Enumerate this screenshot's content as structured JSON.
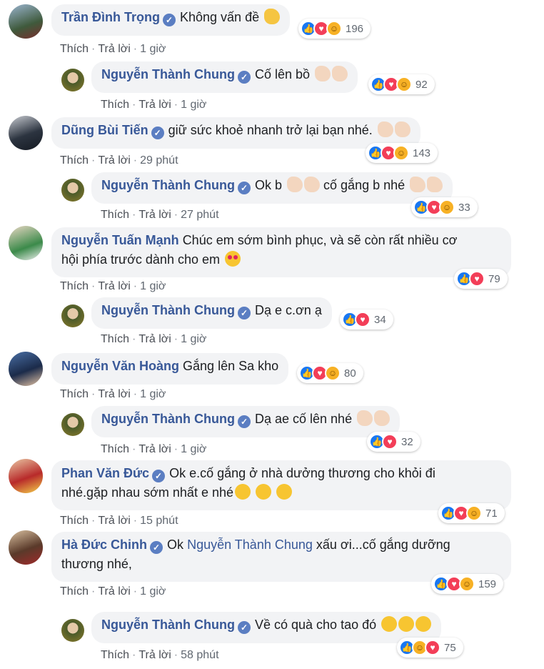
{
  "colors": {
    "name": "#385898",
    "bubble": "#f2f3f5",
    "like": "#1877f2",
    "love": "#f33e58",
    "haha": "#f7b125"
  },
  "actions": {
    "like": "Thích",
    "reply": "Trả lời"
  },
  "comments": [
    {
      "name": "Trần Đình Trọng",
      "text": "Không vấn đề",
      "time": "1 giờ",
      "reactions": [
        "like",
        "love",
        "haha"
      ],
      "count": "196"
    },
    {
      "name": "Nguyễn Thành Chung",
      "text": "Cố lên bồ",
      "time": "1 giờ",
      "reactions": [
        "like",
        "love",
        "haha"
      ],
      "count": "92"
    },
    {
      "name": "Dũng Bùi Tiến",
      "text": "giữ sức khoẻ nhanh trở lại bạn nhé.",
      "time": "29 phút",
      "reactions": [
        "like",
        "love",
        "haha"
      ],
      "count": "143"
    },
    {
      "name": "Nguyễn Thành Chung",
      "text": "Ok b",
      "text2": "cố gắng b nhé",
      "time": "27 phút",
      "reactions": [
        "like",
        "love",
        "haha"
      ],
      "count": "33"
    },
    {
      "name": "Nguyễn Tuấn Mạnh",
      "text": "Chúc em sớm bình phục, và sẽ còn rất nhiều cơ",
      "text_line2": "hội phía trước dành cho em",
      "time": "1 giờ",
      "reactions": [
        "like",
        "love"
      ],
      "count": "79"
    },
    {
      "name": "Nguyễn Thành Chung",
      "text": "Dạ e c.ơn ạ",
      "time": "1 giờ",
      "reactions": [
        "like",
        "love"
      ],
      "count": "34"
    },
    {
      "name": "Nguyễn Văn Hoàng",
      "text": "Gắng lên Sa kho",
      "time": "1 giờ",
      "reactions": [
        "like",
        "love",
        "haha"
      ],
      "count": "80"
    },
    {
      "name": "Nguyễn Thành Chung",
      "text": "Dạ ae cố lên nhé",
      "time": "1 giờ",
      "reactions": [
        "like",
        "love"
      ],
      "count": "32"
    },
    {
      "name": "Phan Văn Đức",
      "text": "Ok e.cố gắng ở nhà dưởng thương cho khỏi đi",
      "text_line2": "nhé.gặp nhau sớm nhất e nhé",
      "time": "15 phút",
      "reactions": [
        "like",
        "love",
        "haha"
      ],
      "count": "71"
    },
    {
      "name": "Hà Đức Chinh",
      "text_pre": "Ok",
      "mention": "Nguyễn Thành Chung",
      "text": "xấu ơi...cố gắng dưỡng",
      "text_line2": "thương nhé,",
      "time": "1 giờ",
      "reactions": [
        "like",
        "love",
        "haha"
      ],
      "count": "159"
    },
    {
      "name": "Nguyễn Thành Chung",
      "text": "Về có quà cho tao đó",
      "time": "58 phút",
      "reactions": [
        "like",
        "haha",
        "love"
      ],
      "count": "75"
    }
  ]
}
